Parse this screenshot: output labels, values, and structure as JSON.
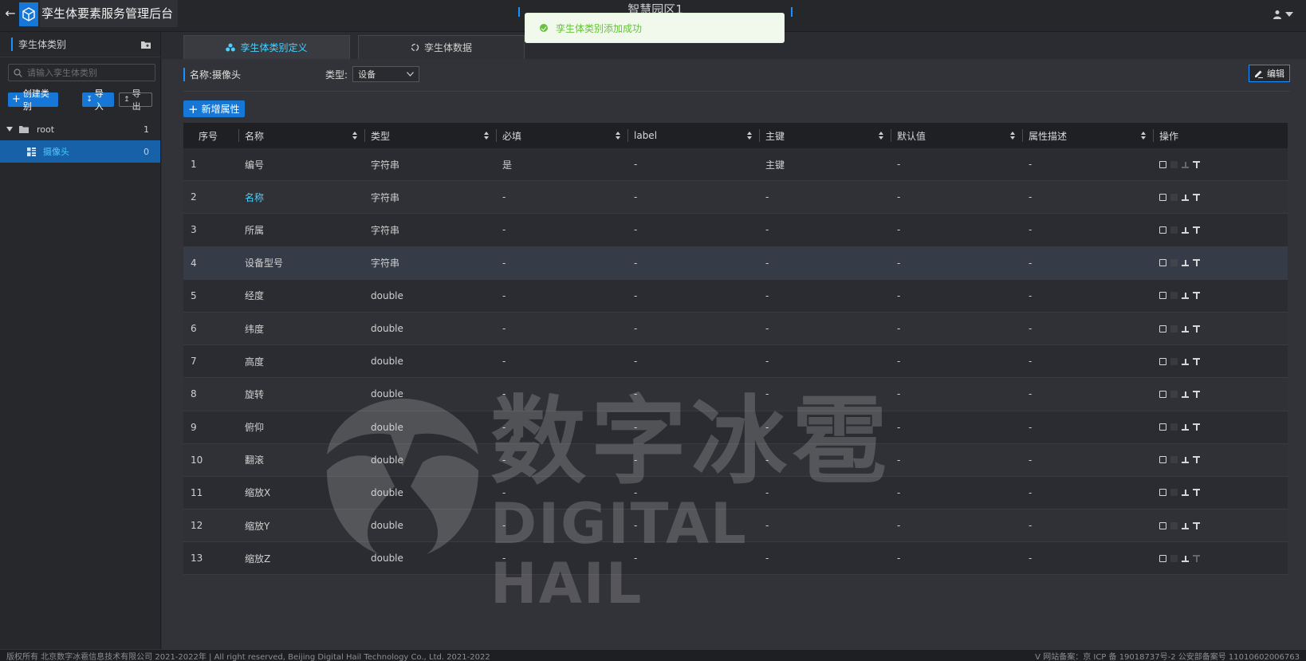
{
  "header": {
    "app_title": "孪生体要素服务管理后台",
    "center_title": "智慧园区1"
  },
  "toast": {
    "message": "孪生体类别添加成功"
  },
  "sidebar": {
    "title": "孪生体类别",
    "search_placeholder": "请输入孪生体类别",
    "create_label": "创建类别",
    "import_label": "导入",
    "export_label": "导出",
    "tree": [
      {
        "label": "root",
        "count": "1"
      },
      {
        "label": "摄像头",
        "count": "0"
      }
    ]
  },
  "tabs": [
    {
      "label": "孪生体类别定义"
    },
    {
      "label": "孪生体数据"
    }
  ],
  "detail": {
    "name_label": "名称:摄像头",
    "type_label": "类型:",
    "type_value": "设备",
    "edit_label": "编辑",
    "add_attr_label": "新增属性"
  },
  "table": {
    "headers": [
      "序号",
      "名称",
      "类型",
      "必填",
      "label",
      "主键",
      "默认值",
      "属性描述",
      "操作"
    ],
    "rows": [
      {
        "idx": "1",
        "name": "编号",
        "type": "字符串",
        "required": "是",
        "label": "-",
        "pk": "主键",
        "default": "-",
        "desc": "-"
      },
      {
        "idx": "2",
        "name": "名称",
        "type": "字符串",
        "required": "-",
        "label": "-",
        "pk": "-",
        "default": "-",
        "desc": "-"
      },
      {
        "idx": "3",
        "name": "所属",
        "type": "字符串",
        "required": "-",
        "label": "-",
        "pk": "-",
        "default": "-",
        "desc": "-"
      },
      {
        "idx": "4",
        "name": "设备型号",
        "type": "字符串",
        "required": "-",
        "label": "-",
        "pk": "-",
        "default": "-",
        "desc": "-"
      },
      {
        "idx": "5",
        "name": "经度",
        "type": "double",
        "required": "-",
        "label": "-",
        "pk": "-",
        "default": "-",
        "desc": "-"
      },
      {
        "idx": "6",
        "name": "纬度",
        "type": "double",
        "required": "-",
        "label": "-",
        "pk": "-",
        "default": "-",
        "desc": "-"
      },
      {
        "idx": "7",
        "name": "高度",
        "type": "double",
        "required": "-",
        "label": "-",
        "pk": "-",
        "default": "-",
        "desc": "-"
      },
      {
        "idx": "8",
        "name": "旋转",
        "type": "double",
        "required": "-",
        "label": "-",
        "pk": "-",
        "default": "-",
        "desc": "-"
      },
      {
        "idx": "9",
        "name": "俯仰",
        "type": "double",
        "required": "-",
        "label": "-",
        "pk": "-",
        "default": "-",
        "desc": "-"
      },
      {
        "idx": "10",
        "name": "翻滚",
        "type": "double",
        "required": "-",
        "label": "-",
        "pk": "-",
        "default": "-",
        "desc": "-"
      },
      {
        "idx": "11",
        "name": "缩放X",
        "type": "double",
        "required": "-",
        "label": "-",
        "pk": "-",
        "default": "-",
        "desc": "-"
      },
      {
        "idx": "12",
        "name": "缩放Y",
        "type": "double",
        "required": "-",
        "label": "-",
        "pk": "-",
        "default": "-",
        "desc": "-"
      },
      {
        "idx": "13",
        "name": "缩放Z",
        "type": "double",
        "required": "-",
        "label": "-",
        "pk": "-",
        "default": "-",
        "desc": "-"
      }
    ]
  },
  "watermark": {
    "cn": "数字冰雹",
    "en": "DIGITAL HAIL"
  },
  "footer": {
    "left": "版权所有 北京数字冰雹信息技术有限公司 2021-2022年 | All right reserved, Beijing Digital Hail Technology Co., Ltd. 2021-2022",
    "right": "V 网站备案：京 ICP 备 19018737号-2 公安部备案号 11010602006763"
  },
  "colors": {
    "accent": "#1677d6",
    "link": "#48d1ff",
    "success": "#67c23a"
  }
}
